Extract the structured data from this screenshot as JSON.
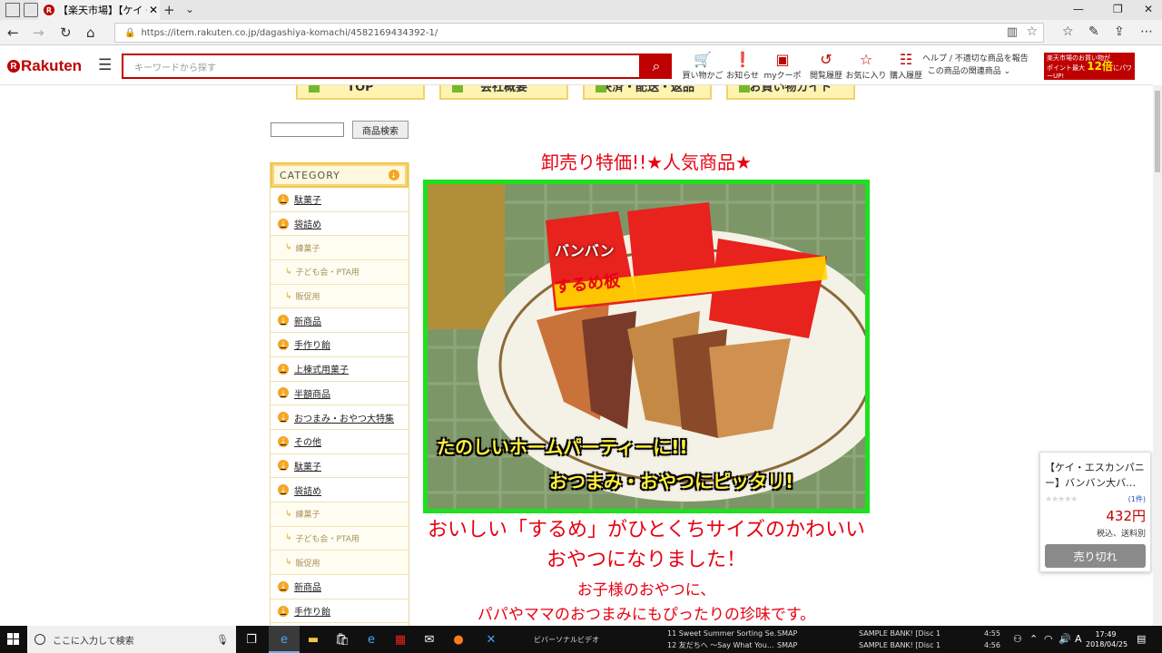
{
  "browser": {
    "tab_title": "【楽天市場】【ケイ・エスカン",
    "url": "https://item.rakuten.co.jp/dagashiya-komachi/4582169434392-1/"
  },
  "rakuten_header": {
    "logo": "Rakuten",
    "search_placeholder": "キーワードから探す",
    "nav_items": [
      {
        "label": "買い物かご",
        "icon": "cart-icon"
      },
      {
        "label": "お知らせ",
        "icon": "notice-icon"
      },
      {
        "label": "myクーポン",
        "icon": "coupon-icon"
      },
      {
        "label": "閲覧履歴",
        "icon": "history-icon"
      },
      {
        "label": "お気に入り",
        "icon": "star-icon"
      },
      {
        "label": "購入履歴",
        "icon": "receipt-icon"
      }
    ],
    "help_line1": "ヘルプ / 不適切な商品を報告",
    "help_line2": "この商品の関連商品",
    "spu_line1": "楽天市場のお買い物が",
    "spu_line2": "ポイント最大",
    "spu_big": "12倍",
    "spu_line3": "にパワーUP!"
  },
  "shop": {
    "top_nav": [
      "TOP",
      "会社概要",
      "決済・配送・返品",
      "お買い物ガイド"
    ],
    "search_button": "商品検索",
    "category_title": "CATEGORY",
    "categories": [
      {
        "label": "駄菓子",
        "sub": false
      },
      {
        "label": "袋詰め",
        "sub": false
      },
      {
        "label": "練菓子",
        "sub": true
      },
      {
        "label": "子ども会・PTA用",
        "sub": true
      },
      {
        "label": "販促用",
        "sub": true
      },
      {
        "label": "新商品",
        "sub": false
      },
      {
        "label": "手作り飴",
        "sub": false
      },
      {
        "label": "上棟式用菓子",
        "sub": false
      },
      {
        "label": "半額商品",
        "sub": false
      },
      {
        "label": "おつまみ・おやつ大特集",
        "sub": false
      },
      {
        "label": "その他",
        "sub": false
      },
      {
        "label": "駄菓子",
        "sub": false
      },
      {
        "label": "袋詰め",
        "sub": false
      },
      {
        "label": "練菓子",
        "sub": true
      },
      {
        "label": "子ども会・PTA用",
        "sub": true
      },
      {
        "label": "販促用",
        "sub": true
      },
      {
        "label": "新商品",
        "sub": false
      },
      {
        "label": "手作り飴",
        "sub": false
      }
    ]
  },
  "product": {
    "headline": "卸売り特価!!★人気商品★",
    "image_caption1": "たのしいホームパーティーに!!",
    "image_caption2": "おつまみ・おやつにピッタリ!",
    "pack_text1": "バンバン",
    "pack_text2": "するめ板",
    "desc1": "おいしい「するめ」がひとくちサイズのかわいいおやつになりました！",
    "desc2_line1": "お子様のおやつに、",
    "desc2_line2": "パパやママのおつまみにもぴったりの珍味です。"
  },
  "popup": {
    "title": "【ケイ・エスカンパニー】バンバン大バ…",
    "review_count": "(1件)",
    "price": "432円",
    "note": "税込、送料別",
    "button": "売り切れ"
  },
  "taskbar": {
    "search_placeholder": "ここに入力して検索",
    "window1": "11 Sweet Summer Sorting Se...",
    "window1b": "12 友だちへ ～Say What You...",
    "window2": "SAMPLE BANK! [Disc 1]",
    "window2b": "SAMPLE BANK! [Disc 1]",
    "artist": "SMAP",
    "time_a": "4:55",
    "time_b": "4:56",
    "partial_label": "ビバーソナルビデオ",
    "clock_time": "17:49",
    "clock_date": "2018/04/25",
    "ime": "A"
  },
  "colors": {
    "rakuten_red": "#bf0000",
    "headline_red": "#e60012",
    "image_border": "#1fe01f",
    "category_gold": "#f5d77c"
  }
}
